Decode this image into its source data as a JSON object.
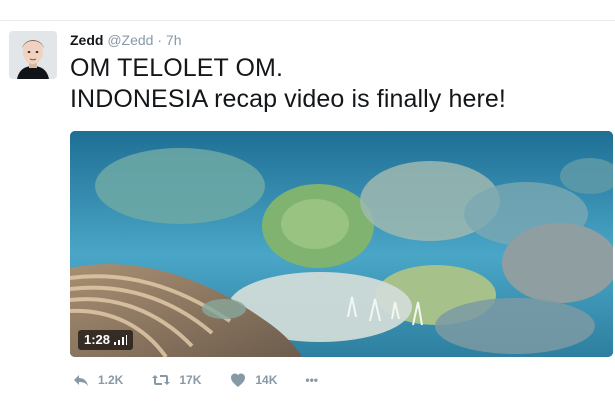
{
  "tweet": {
    "display_name": "Zedd",
    "handle": "@Zedd",
    "separator": "·",
    "time": "7h",
    "text_line1": "OM TELOLET OM.",
    "text_line2": "INDONESIA recap video is finally here!"
  },
  "media": {
    "duration": "1:28",
    "volume_icon": "volume-bars-icon"
  },
  "actions": {
    "reply_count": "1.2K",
    "retweet_count": "17K",
    "like_count": "14K",
    "more_label": "•••"
  },
  "colors": {
    "text": "#14171a",
    "muted": "#8899a6",
    "water": "#3f8fb1"
  }
}
